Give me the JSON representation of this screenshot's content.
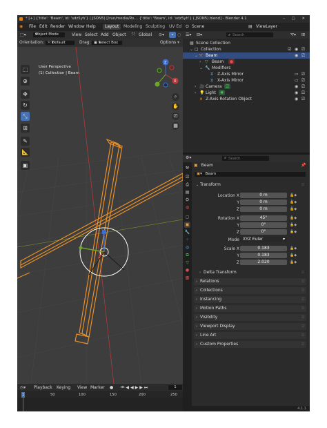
{
  "window": {
    "title": "* [+] {'title': 'Beam', id: 'sdz5yh'} (.JSON5) [/run/media/Ro… {'title': 'Beam', id: 'sdz5yh'} (.JSON5).blend] - Blender 4.1",
    "controls": "– ▢ ✕"
  },
  "menubar": {
    "items": [
      "File",
      "Edit",
      "Render",
      "Window",
      "Help"
    ],
    "tabs": [
      "Layout",
      "Modeling",
      "Sculpting",
      "UV Ed"
    ],
    "scene": "Scene",
    "view_layer": "ViewLayer"
  },
  "viewport": {
    "mode": "Object Mode",
    "menus": [
      "View",
      "Select",
      "Add",
      "Object"
    ],
    "transform_orientation": "Global",
    "orientation_label": "Orientation:",
    "orientation_value": "Default",
    "drag_label": "Drag:",
    "drag_value": "Select Box",
    "options": "Options",
    "overlay_line1": "User Perspective",
    "overlay_line2": "(1) Collection | Beam",
    "gizmo_labels": [
      "X",
      "Y",
      "Z"
    ]
  },
  "timeline": {
    "menus": [
      "Playback",
      "Keying",
      "View",
      "Marker"
    ],
    "current_frame": "1",
    "ruler": [
      "1",
      "50",
      "100",
      "150",
      "200",
      "250"
    ]
  },
  "outliner": {
    "search_placeholder": "Search",
    "rows": [
      {
        "label": "Scene Collection",
        "indent": 0
      },
      {
        "label": "Collection",
        "indent": 1
      },
      {
        "label": "Beam",
        "indent": 2
      },
      {
        "label": "Beam",
        "indent": 3
      },
      {
        "label": "Modifiers",
        "indent": 3
      },
      {
        "label": "Z-Axis Mirror",
        "indent": 4
      },
      {
        "label": "X-Axis Mirror",
        "indent": 4
      },
      {
        "label": "Camera",
        "indent": 2
      },
      {
        "label": "Light",
        "indent": 2
      },
      {
        "label": "Z-Axis Rotation Object",
        "indent": 2
      }
    ]
  },
  "properties": {
    "search_placeholder": "Search",
    "object_name": "Beam",
    "data_name": "Beam",
    "transform_label": "Transform",
    "location_label": "Location X",
    "location": {
      "x": "0 m",
      "y": "0 m",
      "z": "0 m"
    },
    "rotation_label": "Rotation X",
    "rotation": {
      "x": "45°",
      "y": "0°",
      "z": "0°"
    },
    "mode_label": "Mode",
    "mode_value": "XYZ Euler",
    "scale_label": "Scale X",
    "scale": {
      "x": "0.183",
      "y": "0.183",
      "z": "2.020"
    },
    "axis_y": "Y",
    "axis_z": "Z",
    "panels": [
      "Delta Transform",
      "Relations",
      "Collections",
      "Instancing",
      "Motion Paths",
      "Visibility",
      "Viewport Display",
      "Line Art",
      "Custom Properties"
    ]
  },
  "status": {
    "version": "4.1.1"
  }
}
